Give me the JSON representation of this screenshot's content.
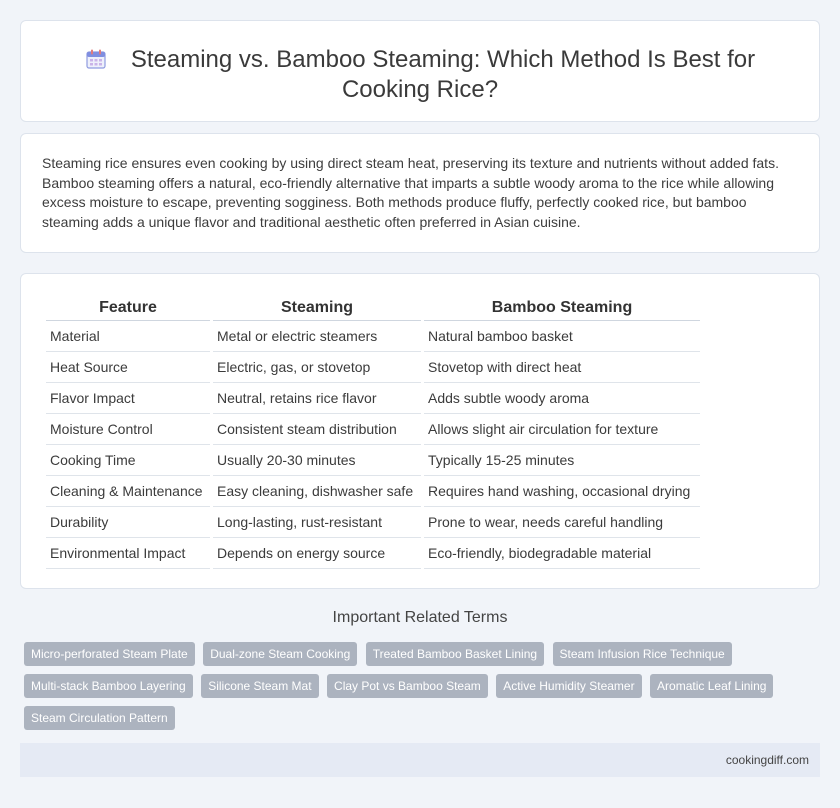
{
  "header": {
    "title": "Steaming vs. Bamboo Steaming: Which Method Is Best for Cooking Rice?",
    "icon": "calendar-icon"
  },
  "summary": {
    "text": "Steaming rice ensures even cooking by using direct steam heat, preserving its texture and nutrients without added fats. Bamboo steaming offers a natural, eco-friendly alternative that imparts a subtle woody aroma to the rice while allowing excess moisture to escape, preventing sogginess. Both methods produce fluffy, perfectly cooked rice, but bamboo steaming adds a unique flavor and traditional aesthetic often preferred in Asian cuisine."
  },
  "table": {
    "headers": [
      "Feature",
      "Steaming",
      "Bamboo Steaming"
    ],
    "rows": [
      [
        "Material",
        "Metal or electric steamers",
        "Natural bamboo basket"
      ],
      [
        "Heat Source",
        "Electric, gas, or stovetop",
        "Stovetop with direct heat"
      ],
      [
        "Flavor Impact",
        "Neutral, retains rice flavor",
        "Adds subtle woody aroma"
      ],
      [
        "Moisture Control",
        "Consistent steam distribution",
        "Allows slight air circulation for texture"
      ],
      [
        "Cooking Time",
        "Usually 20-30 minutes",
        "Typically 15-25 minutes"
      ],
      [
        "Cleaning & Maintenance",
        "Easy cleaning, dishwasher safe",
        "Requires hand washing, occasional drying"
      ],
      [
        "Durability",
        "Long-lasting, rust-resistant",
        "Prone to wear, needs careful handling"
      ],
      [
        "Environmental Impact",
        "Depends on energy source",
        "Eco-friendly, biodegradable material"
      ]
    ]
  },
  "related": {
    "title": "Important Related Terms",
    "tags": [
      "Micro-perforated Steam Plate",
      "Dual-zone Steam Cooking",
      "Treated Bamboo Basket Lining",
      "Steam Infusion Rice Technique",
      "Multi-stack Bamboo Layering",
      "Silicone Steam Mat",
      "Clay Pot vs Bamboo Steam",
      "Active Humidity Steamer",
      "Aromatic Leaf Lining",
      "Steam Circulation Pattern"
    ]
  },
  "footer": {
    "site": "cookingdiff.com"
  }
}
